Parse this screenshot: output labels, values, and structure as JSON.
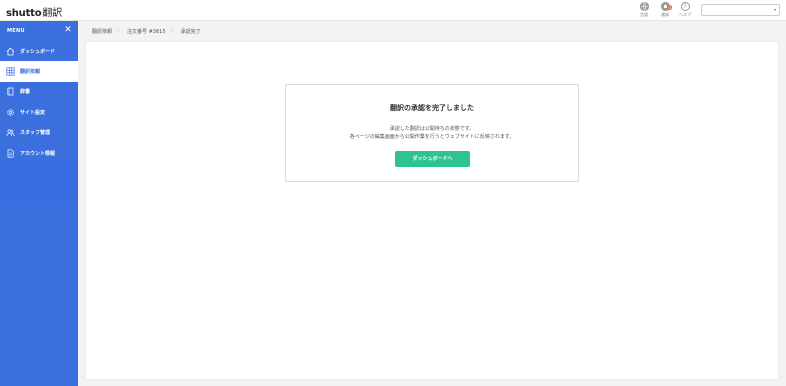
{
  "app": {
    "logo": "shutto",
    "logo_suffix": "翻訳"
  },
  "header": {
    "tools": [
      {
        "icon": "globe-icon",
        "label": "言語"
      },
      {
        "icon": "bell-icon",
        "label": "通知",
        "badge": "0"
      },
      {
        "icon": "help-icon",
        "label": "ヘルプ"
      }
    ],
    "language_select": {
      "value": ""
    }
  },
  "sidebar": {
    "menu_title": "MENU",
    "items": [
      {
        "label": "ダッシュボード",
        "icon": "home-icon",
        "active": false
      },
      {
        "label": "翻訳依頼",
        "icon": "grid-icon",
        "active": true
      },
      {
        "label": "辞書",
        "icon": "book-icon",
        "active": false
      },
      {
        "label": "サイト設定",
        "icon": "gear-icon",
        "active": false
      },
      {
        "label": "スタッフ管理",
        "icon": "users-icon",
        "active": false
      },
      {
        "label": "アカウント情報",
        "icon": "document-icon",
        "active": false
      }
    ]
  },
  "breadcrumb": [
    "翻訳依頼",
    "注文番号 #3615",
    "承認完了"
  ],
  "card": {
    "title": "翻訳の承認を完了しました",
    "line1": "承認した翻訳は公開待ちの状態です。",
    "line2": "各ページの編集画面から公開作業を行うとウェブサイトに反映されます。",
    "button": "ダッシュボードへ"
  },
  "colors": {
    "sidebar": "#3b6fdd",
    "accent_button": "#2fc48f"
  }
}
